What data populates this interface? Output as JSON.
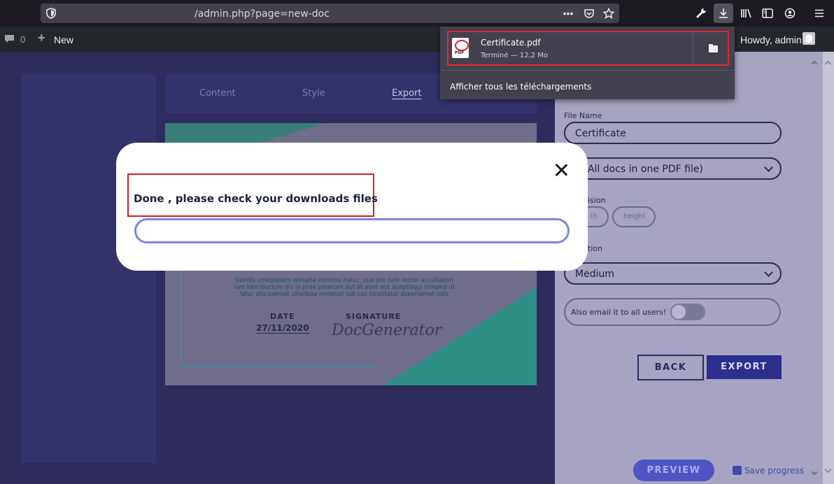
{
  "browser": {
    "url": "/admin.php?page=new-doc",
    "toolbar_icons": [
      "shield-icon",
      "more-icon",
      "pocket-icon",
      "star-icon",
      "wrench-icon",
      "download-icon",
      "library-icon",
      "sidebar-icon",
      "account-icon",
      "menu-icon"
    ]
  },
  "adminbar": {
    "comments_count": "0",
    "new_label": "New",
    "greeting": "Howdy, admin"
  },
  "editor": {
    "tabs": [
      "Content",
      "Style",
      "Export"
    ],
    "active_tab": "Export",
    "certificate": {
      "body_text": "Gendis voluptatem dolupta excerov itatur, que pro tem rectur accullabori ium iduciducium dis in prae porerum aut at abor aut aceptisqui nimped ut latur alis eseniet ulloribea nimetuir odi cus nossitatur asperiamet odis",
      "date_label": "DATE",
      "date_value": "27/11/2020",
      "signature_label": "SIGNATURE",
      "signature_value": "DocGenerator"
    }
  },
  "settings": {
    "file_name_label": "File Name",
    "file_name_value": "Certificate",
    "format_value": "F (All docs in one PDF file)",
    "dimension_label": "ision",
    "width_placeholder": "th",
    "height_placeholder": "height",
    "resolution_label": "tion",
    "resolution_value": "Medium",
    "email_label": "Also email it to all users!",
    "back_label": "BACK",
    "export_label": "EXPORT",
    "preview_label": "PREVIEW",
    "save_progress_label": "Save progress"
  },
  "modal": {
    "message": "Done , please check your downloads files"
  },
  "downloads": {
    "file_name": "Certificate.pdf",
    "status": "Terminé — 12,2 Mo",
    "show_all": "Afficher tous les téléchargements"
  },
  "colors": {
    "highlight": "#d31f26",
    "export_button": "#2c2f8c",
    "preview_button": "#4f55c3"
  }
}
